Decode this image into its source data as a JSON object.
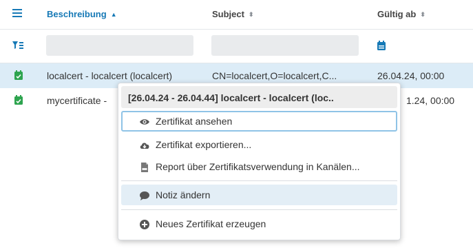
{
  "header": {
    "columns": [
      {
        "label": "Beschreibung",
        "sort": "ascending"
      },
      {
        "label": "Subject",
        "sort": "none"
      },
      {
        "label": "Gültig ab",
        "sort": "none"
      }
    ]
  },
  "rows": [
    {
      "description": "localcert - localcert (localcert)",
      "subject": "CN=localcert,O=localcert,C...",
      "valid_from": "26.04.24, 00:00",
      "selected": true,
      "icon": "calendar-check-icon"
    },
    {
      "description": "mycertificate -",
      "subject": "",
      "valid_from": "1.24, 00:00",
      "selected": false,
      "icon": "calendar-check-icon"
    }
  ],
  "context_menu": {
    "title": "[26.04.24 - 26.04.44] localcert - localcert (loc..",
    "items": [
      {
        "label": "Zertifikat ansehen",
        "icon": "eye-icon",
        "state": "focused"
      },
      {
        "label": "Zertifikat exportieren...",
        "icon": "cloud-download-icon",
        "state": "normal"
      },
      {
        "label": "Report über Zertifikatsverwendung in Kanälen...",
        "icon": "pdf-file-icon",
        "state": "normal"
      },
      {
        "label": "Notiz ändern",
        "icon": "comment-icon",
        "state": "hover"
      },
      {
        "label": "Neues Zertifikat erzeugen",
        "icon": "plus-circle-icon",
        "state": "normal"
      }
    ]
  },
  "colors": {
    "accent": "#1679b6",
    "green_icon": "#2ea44f",
    "selected_row": "#dcecf7"
  }
}
